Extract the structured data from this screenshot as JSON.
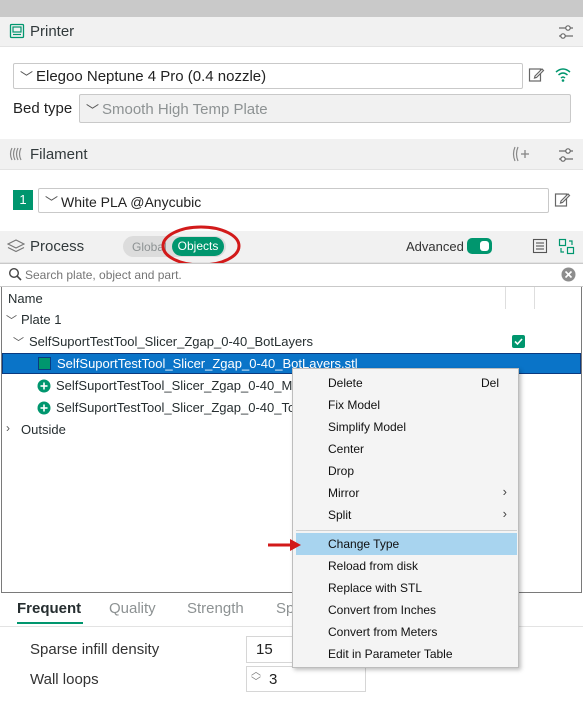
{
  "printer": {
    "title": "Printer",
    "printer_name": "Elegoo Neptune 4 Pro (0.4 nozzle)",
    "bed_type_label": "Bed type",
    "bed_type_value": "Smooth High Temp Plate"
  },
  "filament": {
    "title": "Filament",
    "slot_number": "1",
    "value": "White PLA @Anycubic"
  },
  "process": {
    "title": "Process",
    "toggle_global": "Global",
    "toggle_objects": "Objects",
    "advanced_label": "Advanced",
    "advanced_on": true
  },
  "search": {
    "placeholder": "Search plate, object and part."
  },
  "tree": {
    "header": "Name",
    "plate": "Plate 1",
    "object": "SelfSuportTestTool_Slicer_Zgap_0-40_BotLayers",
    "part1": "SelfSuportTestTool_Slicer_Zgap_0-40_BotLayers.stl",
    "part2": "SelfSuportTestTool_Slicer_Zgap_0-40_Ma",
    "part3": "SelfSuportTestTool_Slicer_Zgap_0-40_Top",
    "outside": "Outside"
  },
  "tabs": [
    "Frequent",
    "Quality",
    "Strength",
    "Sp"
  ],
  "settings": {
    "sparse_infill_label": "Sparse infill density",
    "sparse_infill_value": "15",
    "wall_loops_label": "Wall loops",
    "wall_loops_value": "3"
  },
  "context_menu": {
    "delete": "Delete",
    "delete_shortcut": "Del",
    "fix_model": "Fix Model",
    "simplify_model": "Simplify Model",
    "center": "Center",
    "drop": "Drop",
    "mirror": "Mirror",
    "split": "Split",
    "change_type": "Change Type",
    "reload_from_disk": "Reload from disk",
    "replace_with_stl": "Replace with STL",
    "convert_from_inches": "Convert from Inches",
    "convert_from_meters": "Convert from Meters",
    "edit_in_parameter_table": "Edit in Parameter Table"
  },
  "colors": {
    "accent": "#00966e",
    "selection": "#0a74c8",
    "menu_highlight": "#a8d4ef",
    "annotation_red": "#d21a1a"
  }
}
